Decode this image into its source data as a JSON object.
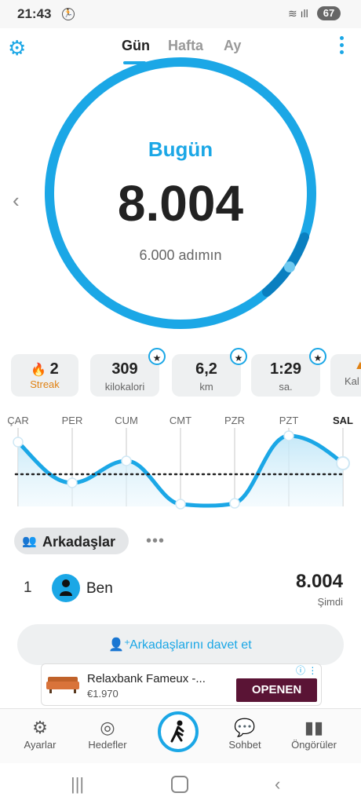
{
  "status": {
    "time": "21:43",
    "battery": "67"
  },
  "header": {
    "tabs": [
      "Gün",
      "Hafta",
      "Ay"
    ],
    "active_tab": "Gün"
  },
  "ring": {
    "title": "Bugün",
    "steps": "8.004",
    "goal_text": "6.000 adımın",
    "progress": 1.0
  },
  "stats": {
    "streak": {
      "value": "2",
      "label": "Streak"
    },
    "calories": {
      "value": "309",
      "label": "kilokalori"
    },
    "distance": {
      "value": "6,2",
      "label": "km"
    },
    "time": {
      "value": "1:29",
      "label": "sa."
    },
    "partial": {
      "label": "Kal"
    }
  },
  "week_chart": {
    "days": [
      "ÇAR",
      "PER",
      "CUM",
      "CMT",
      "PZR",
      "PZT",
      "SAL"
    ],
    "today": "SAL"
  },
  "friends": {
    "title": "Arkadaşlar",
    "more": "•••",
    "list": [
      {
        "rank": "1",
        "name": "Ben",
        "steps": "8.004",
        "time": "Şimdi"
      }
    ],
    "invite_label": "Arkadaşlarını davet et"
  },
  "ad": {
    "name": "Relaxbank Fameux -...",
    "price": "€1.970",
    "button": "OPENEN"
  },
  "bottom_nav": {
    "items": [
      "Ayarlar",
      "Hedefler",
      "Sohbet",
      "Öngörüler"
    ]
  },
  "colors": {
    "accent": "#1ba7e6",
    "ad_button": "#5a1435",
    "streak": "#e08214"
  }
}
